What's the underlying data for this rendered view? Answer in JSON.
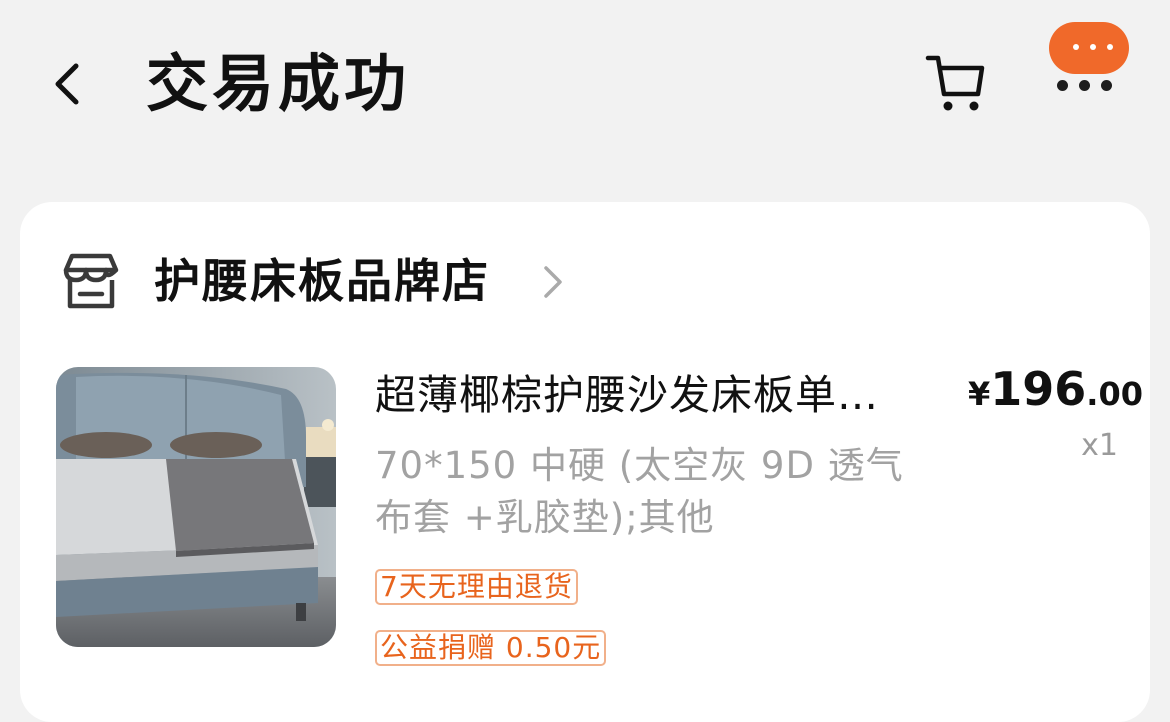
{
  "header": {
    "title": "交易成功",
    "icons": [
      "back-arrow-icon",
      "cart-icon",
      "more-icon"
    ],
    "accent_color": "#f0692a"
  },
  "store": {
    "name": "护腰床板品牌店",
    "icon": "store-icon"
  },
  "product": {
    "title": "超薄椰棕护腰沙发床板单…",
    "sku": "70*150 中硬 (太空灰 9D 透气布套 +乳胶垫);其他",
    "price_currency": "¥",
    "price_integer": "196",
    "price_decimal": ".00",
    "quantity": "x1",
    "tags": [
      "7天无理由退货",
      "公益捐赠 0.50元"
    ]
  }
}
